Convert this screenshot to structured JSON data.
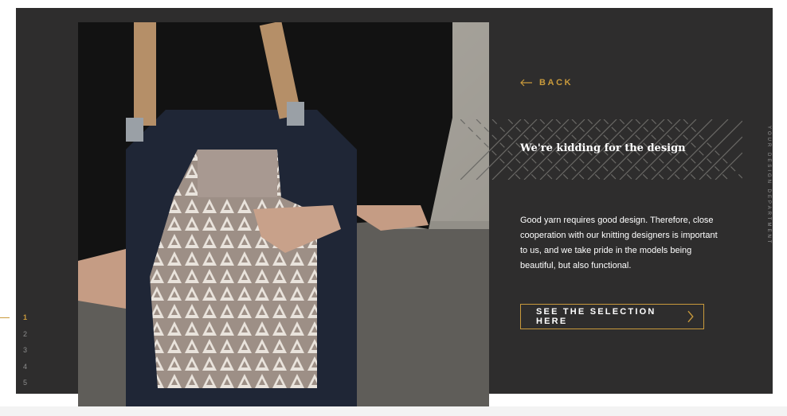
{
  "nav": {
    "back_label": "BACK",
    "back_icon": "arrow-left-icon"
  },
  "content": {
    "heading": "We're kidding for the design",
    "body": "Good yarn requires good design. Therefore, close cooperation with our knitting designers is important to us, and we take pride in the models being beautiful, but also functional.",
    "cta_label": "SEE THE SELECTION HERE",
    "cta_icon": "chevron-right-icon"
  },
  "side_label": "YOUR DESIGN DEPARTMENT",
  "pagination": {
    "items": [
      "1",
      "2",
      "3",
      "4",
      "5"
    ],
    "active": "1"
  },
  "image": {
    "alt": "woman-in-apron-holding-folded-knitted-sweater"
  },
  "colors": {
    "accent": "#c99a3c",
    "panel_bg": "#2e2d2d",
    "text": "#ffffff",
    "muted": "#8c8c8c"
  }
}
